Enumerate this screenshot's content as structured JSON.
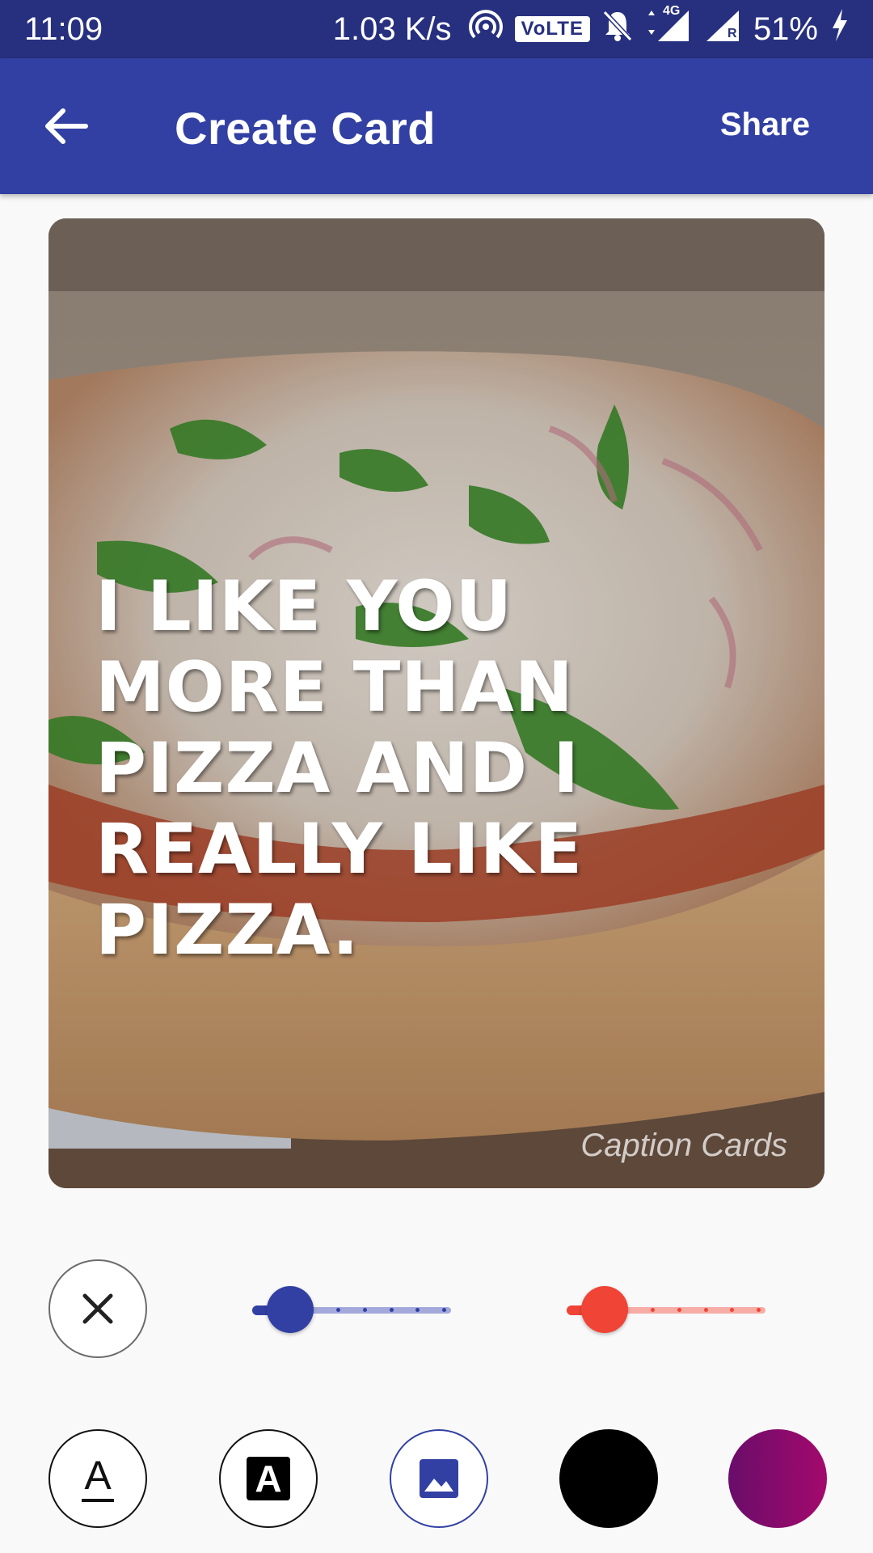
{
  "status_bar": {
    "time": "11:09",
    "net_speed": "1.03 K/s",
    "volte": "VoLTE",
    "network_label": "4G",
    "roaming_label": "R",
    "battery": "51%"
  },
  "app_bar": {
    "title": "Create Card",
    "share_label": "Share"
  },
  "card": {
    "quote": "I like you more than pizza and I really like pizza.",
    "watermark": "Caption Cards",
    "photo_subject": "pizza with onions and green peppers"
  },
  "controls": {
    "slider_primary": {
      "value": 0.19,
      "color": "#3240a3"
    },
    "slider_secondary": {
      "value": 0.19,
      "color": "#ef4436"
    },
    "text_style_glyph": "A",
    "text_background_glyph": "A",
    "color_options": [
      "#000000",
      "#8a0b6b"
    ]
  },
  "colors": {
    "status_bar": "#27307f",
    "app_bar": "#3240a3",
    "accent_blue": "#3240a3",
    "accent_red": "#ef4436"
  }
}
